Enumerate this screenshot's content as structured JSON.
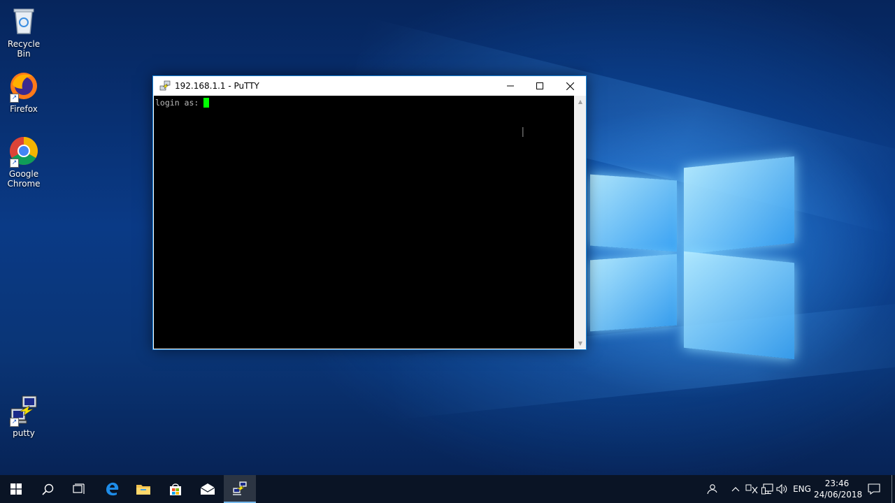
{
  "desktop": {
    "icons": [
      {
        "label": "Recycle Bin"
      },
      {
        "label": "Firefox"
      },
      {
        "label": "Google Chrome"
      },
      {
        "label": "putty"
      }
    ]
  },
  "window": {
    "title": "192.168.1.1 - PuTTY",
    "terminal_prompt": "login as: "
  },
  "taskbar": {
    "language": "ENG",
    "time": "23:46",
    "date": "24/06/2018"
  },
  "colors": {
    "cursor": "#00ff00",
    "terminal_bg": "#000000",
    "accent": "#1883d7"
  }
}
